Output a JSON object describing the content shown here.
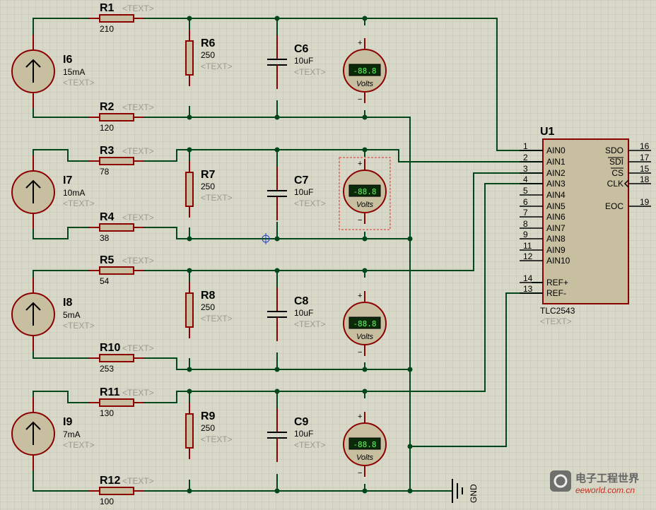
{
  "placeholder": "<TEXT>",
  "sources": [
    {
      "name": "I6",
      "value": "15mA"
    },
    {
      "name": "I7",
      "value": "10mA"
    },
    {
      "name": "I8",
      "value": "5mA"
    },
    {
      "name": "I9",
      "value": "7mA"
    }
  ],
  "series_resistors": [
    {
      "name": "R1",
      "value": "210"
    },
    {
      "name": "R2",
      "value": "120"
    },
    {
      "name": "R3",
      "value": "78"
    },
    {
      "name": "R4",
      "value": "38"
    },
    {
      "name": "R5",
      "value": "54"
    },
    {
      "name": "R10",
      "value": "253"
    },
    {
      "name": "R11",
      "value": "130"
    },
    {
      "name": "R12",
      "value": "100"
    }
  ],
  "shunt_resistors": [
    {
      "name": "R6",
      "value": "250"
    },
    {
      "name": "R7",
      "value": "250"
    },
    {
      "name": "R8",
      "value": "250"
    },
    {
      "name": "R9",
      "value": "250"
    }
  ],
  "capacitors": [
    {
      "name": "C6",
      "value": "10uF"
    },
    {
      "name": "C7",
      "value": "10uF"
    },
    {
      "name": "C8",
      "value": "10uF"
    },
    {
      "name": "C9",
      "value": "10uF"
    }
  ],
  "voltmeter": {
    "display": "-88.8",
    "unit": "Volts",
    "plus": "+",
    "minus": "−"
  },
  "chip": {
    "ref": "U1",
    "part": "TLC2543",
    "left_pins": [
      {
        "num": "1",
        "name": "AIN0"
      },
      {
        "num": "2",
        "name": "AIN1"
      },
      {
        "num": "3",
        "name": "AIN2"
      },
      {
        "num": "4",
        "name": "AIN3"
      },
      {
        "num": "5",
        "name": "AIN4"
      },
      {
        "num": "6",
        "name": "AIN5"
      },
      {
        "num": "7",
        "name": "AIN6"
      },
      {
        "num": "8",
        "name": "AIN7"
      },
      {
        "num": "9",
        "name": "AIN8"
      },
      {
        "num": "11",
        "name": "AIN9"
      },
      {
        "num": "12",
        "name": "AIN10"
      },
      {
        "num": "14",
        "name": "REF+"
      },
      {
        "num": "13",
        "name": "REF-"
      }
    ],
    "right_pins": [
      {
        "num": "16",
        "name": "SDO"
      },
      {
        "num": "17",
        "name": "SDI"
      },
      {
        "num": "15",
        "name": "CS"
      },
      {
        "num": "18",
        "name": "CLK"
      },
      {
        "num": "19",
        "name": "EOC"
      }
    ]
  },
  "ground": {
    "label": "GND"
  },
  "watermark": {
    "brand": "电子工程世界",
    "url": "eeworld.com.cn"
  }
}
